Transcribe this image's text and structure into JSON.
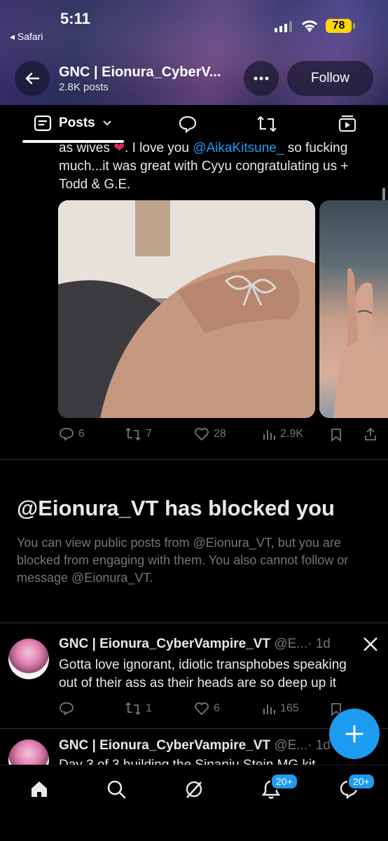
{
  "status_bar": {
    "time": "5:11",
    "back_app": "◂ Safari",
    "battery": "78"
  },
  "header": {
    "account_name": "GNC | Eionura_CyberV...",
    "post_count": "2.8K posts",
    "follow_label": "Follow"
  },
  "tabs": {
    "posts_label": "Posts"
  },
  "post1": {
    "line1_pre": "as wives ",
    "line1_mid": ". I love you ",
    "mention": "@AikaKitsune_",
    "line1_post": " so fucking",
    "line2": "much...it was great with Cyyu congratulating us +",
    "line3": "Todd & G.E.",
    "replies": "6",
    "reposts": "7",
    "likes": "28",
    "views": "2.9K"
  },
  "blocked": {
    "title": "@Eionura_VT has blocked you",
    "body": "You can view public posts from @Eionura_VT, but you are blocked from engaging with them. You also cannot follow or message @Eionura_VT."
  },
  "post2": {
    "name": "GNC | Eionura_CyberVampire_VT",
    "handle": "@E...",
    "time": "· 1d",
    "line1": "Gotta love ignorant, idiotic transphobes speaking",
    "line2": "out of their ass as their heads are so deep up it",
    "replies": "",
    "reposts": "1",
    "likes": "6",
    "views": "165"
  },
  "post3": {
    "name": "GNC | Eionura_CyberVampire_VT",
    "handle": "@E...",
    "time": "· 1d",
    "line1": "Day 3 of 3 building the Sinanju Stein MG kit"
  },
  "bottom_nav": {
    "notifications_badge": "20+",
    "messages_badge": "20+"
  },
  "colors": {
    "accent": "#1d9bf0",
    "muted": "#71767b",
    "battery": "#ffd60a",
    "heart": "#e0245e"
  }
}
